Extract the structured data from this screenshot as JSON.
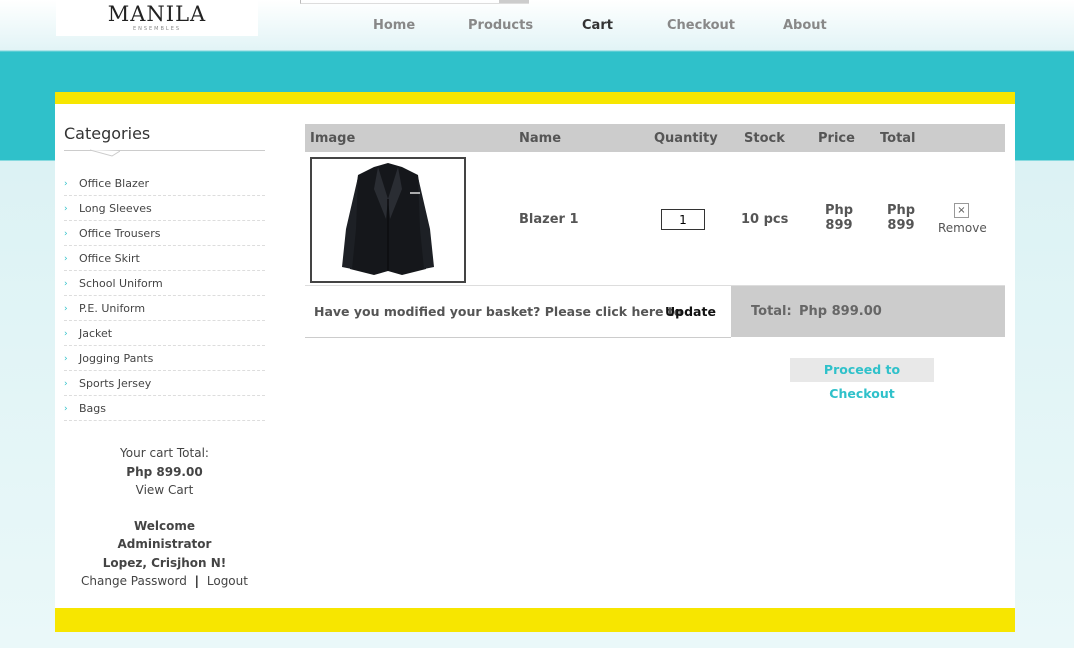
{
  "brand": {
    "name": "MANILA",
    "tagline": "ENSEMBLES"
  },
  "nav": {
    "items": [
      "Home",
      "Products",
      "Cart",
      "Checkout",
      "About"
    ],
    "active": "Cart"
  },
  "sidebar": {
    "title": "Categories",
    "categories": [
      "Office Blazer",
      "Long Sleeves",
      "Office Trousers",
      "Office Skirt",
      "School Uniform",
      "P.E. Uniform",
      "Jacket",
      "Jogging Pants",
      "Sports Jersey",
      "Bags"
    ],
    "cart_label": "Your cart Total:",
    "cart_total": "Php 899.00",
    "view_cart": "View Cart",
    "welcome": "Welcome",
    "role": "Administrator",
    "user_name": "Lopez, Crisjhon N!",
    "change_password": "Change Password",
    "separator": "|",
    "logout": "Logout"
  },
  "cart": {
    "headers": {
      "image": "Image",
      "name": "Name",
      "quantity": "Quantity",
      "stock": "Stock",
      "price": "Price",
      "total": "Total"
    },
    "items": [
      {
        "name": "Blazer 1",
        "quantity": "1",
        "stock": "10 pcs",
        "price_currency": "Php",
        "price_value": "899",
        "total_currency": "Php",
        "total_value": "899",
        "remove_icon": "×",
        "remove_label": "Remove"
      }
    ],
    "update_prompt": "Have you modified your basket? Please click here to",
    "update_label": "Update",
    "total_label": "Total:",
    "total_value": "Php 899.00",
    "checkout_label": "Proceed to Checkout"
  },
  "colors": {
    "accent": "#2fc1ca",
    "banner_yellow": "#f7e600",
    "header_gray": "#cccccc"
  },
  "icons": {
    "category_bullet": "chevron-right-icon",
    "remove": "close-icon"
  }
}
